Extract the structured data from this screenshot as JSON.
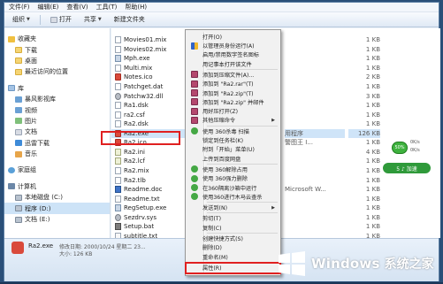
{
  "menubar": {
    "items": [
      "文件(F)",
      "编辑(E)",
      "查看(V)",
      "工具(T)",
      "帮助(H)"
    ]
  },
  "toolbar": {
    "organize": "组织",
    "open": "打开",
    "share": "共享",
    "new_folder": "新建文件夹"
  },
  "nav": {
    "items": [
      {
        "label": "收藏夹",
        "icon": "star-icon"
      },
      {
        "label": "下载",
        "icon": "folder-icon"
      },
      {
        "label": "桌面",
        "icon": "folder-icon"
      },
      {
        "label": "最近访问的位置",
        "icon": "folder-icon"
      },
      {
        "label": "库",
        "icon": "library-icon"
      },
      {
        "label": "暴风影视库",
        "icon": "video-icon"
      },
      {
        "label": "视频",
        "icon": "video-icon"
      },
      {
        "label": "图片",
        "icon": "image-icon"
      },
      {
        "label": "文档",
        "icon": "document-icon"
      },
      {
        "label": "迅雷下载",
        "icon": "thunder-icon"
      },
      {
        "label": "音乐",
        "icon": "music-icon"
      },
      {
        "label": "家庭组",
        "icon": "homegroup-icon"
      },
      {
        "label": "计算机",
        "icon": "computer-icon"
      },
      {
        "label": "本地磁盘 (C:)",
        "icon": "disk-icon"
      },
      {
        "label": "程序 (D:)",
        "icon": "disk-icon"
      },
      {
        "label": "文档 (E:)",
        "icon": "disk-icon"
      }
    ]
  },
  "files": {
    "rows": [
      {
        "name": "Movies01.mix",
        "type": "",
        "size": "1 KB"
      },
      {
        "name": "Movies02.mix",
        "type": "",
        "size": "1 KB"
      },
      {
        "name": "Mph.exe",
        "type": "",
        "size": "1 KB"
      },
      {
        "name": "Multi.mix",
        "type": "",
        "size": "1 KB"
      },
      {
        "name": "Notes.ico",
        "type": "",
        "size": "2 KB"
      },
      {
        "name": "Patchget.dat",
        "type": "",
        "size": "1 KB"
      },
      {
        "name": "Patchw32.dll",
        "type": "",
        "size": "3 KB"
      },
      {
        "name": "Ra1.dsk",
        "type": "",
        "size": "1 KB"
      },
      {
        "name": "ra2.csf",
        "type": "",
        "size": "1 KB"
      },
      {
        "name": "Ra2.dsk",
        "type": "",
        "size": "1 KB"
      },
      {
        "name": "Ra2.exe",
        "type": "用程序",
        "size": "126 KB"
      },
      {
        "name": "Ra2.ico",
        "type": "警图王 I...",
        "size": "1 KB"
      },
      {
        "name": "Ra2.ini",
        "type": "",
        "size": "4 KB"
      },
      {
        "name": "Ra2.lcf",
        "type": "",
        "size": "1 KB"
      },
      {
        "name": "Ra2.mix",
        "type": "",
        "size": "1 KB"
      },
      {
        "name": "Ra2.tlb",
        "type": "",
        "size": "1 KB"
      },
      {
        "name": "Readme.doc",
        "type": "Microsoft W...",
        "size": "1 KB"
      },
      {
        "name": "Readme.txt",
        "type": "",
        "size": "1 KB"
      },
      {
        "name": "RegSetup.exe",
        "type": "",
        "size": "1 KB"
      },
      {
        "name": "Sezdrv.sys",
        "type": "",
        "size": "1 KB"
      },
      {
        "name": "Setup.bat",
        "type": "",
        "size": "1 KB"
      },
      {
        "name": "subtitle.txt",
        "type": "",
        "size": "1 KB"
      }
    ]
  },
  "context_menu": {
    "items": [
      {
        "label": "打开(O)",
        "icon": "none",
        "sub": false
      },
      {
        "label": "以管理员身份运行(A)",
        "icon": "shield-icon",
        "sub": false
      },
      {
        "label": "启用/禁用数字签名图标",
        "icon": "none",
        "sub": false
      },
      {
        "label": "用记事本打开该文件",
        "icon": "none",
        "sub": false
      },
      {
        "label": "添加到压缩文件(A)...",
        "icon": "rar-icon",
        "sub": false
      },
      {
        "label": "添加到 \"Ra2.rar\"(T)",
        "icon": "rar-icon",
        "sub": false
      },
      {
        "label": "添加到 \"Ra2.zip\"(T)",
        "icon": "rar-icon",
        "sub": false
      },
      {
        "label": "添加到 \"Ra2.zip\" 并邮件",
        "icon": "rar-icon",
        "sub": false
      },
      {
        "label": "用好压打开(Z)",
        "icon": "rar-icon",
        "sub": false
      },
      {
        "label": "其他压缩命令",
        "icon": "rar-icon",
        "sub": true
      },
      {
        "label": "使用 360杀毒 扫描",
        "icon": "360-icon",
        "sub": false
      },
      {
        "label": "锁定到任务栏(K)",
        "icon": "none",
        "sub": false
      },
      {
        "label": "附到「开始」菜单(U)",
        "icon": "none",
        "sub": false
      },
      {
        "label": "上传到百度网盘",
        "icon": "none",
        "sub": false
      },
      {
        "label": "使用 360解除占用",
        "icon": "360-icon",
        "sub": false
      },
      {
        "label": "使用 360强力删除",
        "icon": "360-icon",
        "sub": false
      },
      {
        "label": "在360隔离沙箱中运行",
        "icon": "360-icon",
        "sub": false
      },
      {
        "label": "使用360进行木马云查杀",
        "icon": "360-icon",
        "sub": false
      },
      {
        "label": "发送到(N)",
        "icon": "none",
        "sub": true
      },
      {
        "label": "剪切(T)",
        "icon": "none",
        "sub": false
      },
      {
        "label": "复制(C)",
        "icon": "none",
        "sub": false
      },
      {
        "label": "创建快捷方式(S)",
        "icon": "none",
        "sub": false
      },
      {
        "label": "删除(D)",
        "icon": "none",
        "sub": false
      },
      {
        "label": "重命名(M)",
        "icon": "none",
        "sub": false
      },
      {
        "label": "属性(R)",
        "icon": "none",
        "sub": false
      }
    ]
  },
  "details": {
    "name": "Ra2.exe",
    "date": "修改日期: 2000/10/24 星期二 23...",
    "size": "大小: 126 KB"
  },
  "tray": {
    "percent": "50%",
    "net_up": "0K/s",
    "net_down": "0K/s",
    "speed_label": "5 ♪ 加速"
  },
  "watermark": {
    "brand": "Windows",
    "cn": "系统之家"
  },
  "colors": {
    "highlight": "#e02020",
    "selection": "#cfe4f8",
    "accent": "#3fb23f"
  }
}
